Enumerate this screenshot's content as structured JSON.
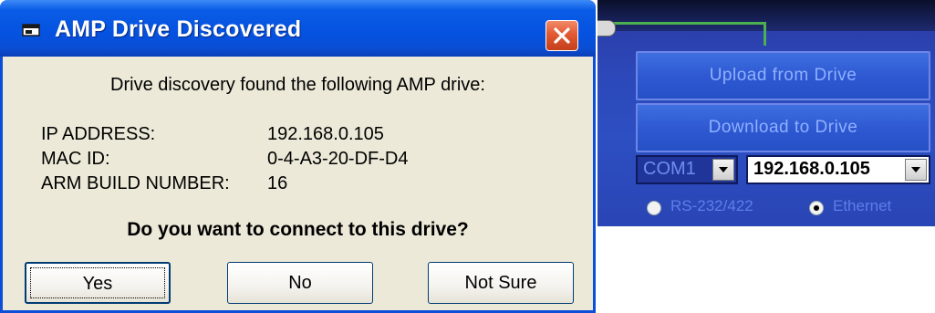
{
  "dialog": {
    "title": "AMP Drive Discovered",
    "intro": "Drive discovery found the following AMP drive:",
    "fields": [
      {
        "label": "IP ADDRESS:",
        "value": "192.168.0.105"
      },
      {
        "label": "MAC ID:",
        "value": "0-4-A3-20-DF-D4"
      },
      {
        "label": "ARM BUILD NUMBER:",
        "value": "16"
      }
    ],
    "question": "Do you want to connect to this drive?",
    "buttons": {
      "yes": "Yes",
      "no": "No",
      "not_sure": "Not Sure"
    }
  },
  "panel": {
    "upload_label": "Upload from Drive",
    "download_label": "Download to Drive",
    "port_value": "COM1",
    "ip_value": "192.168.0.105",
    "radio_serial": "RS-232/422",
    "radio_ethernet": "Ethernet",
    "selected_connection": "Ethernet"
  },
  "colors": {
    "titlebar": "#0552e0",
    "dialog_bg": "#ece9d8",
    "panel_bg": "#2d4fc2",
    "close_button": "#e25a33"
  },
  "icons": [
    "app-window-icon",
    "close-icon",
    "dropdown-arrow-icon",
    "radio-icon"
  ]
}
